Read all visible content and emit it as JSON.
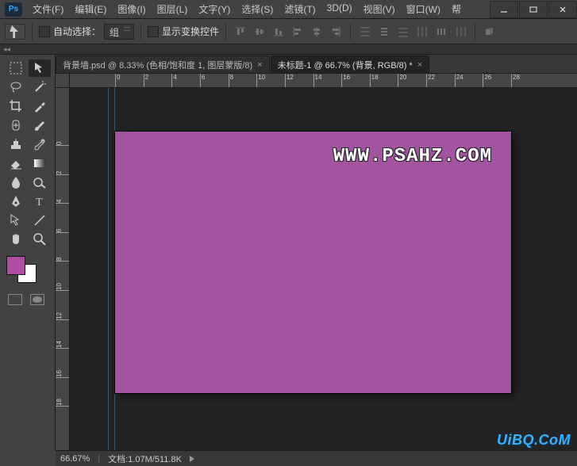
{
  "logo": "Ps",
  "menu": [
    "文件(F)",
    "编辑(E)",
    "图像(I)",
    "图层(L)",
    "文字(Y)",
    "选择(S)",
    "滤镜(T)",
    "3D(D)",
    "视图(V)",
    "窗口(W)",
    "帮"
  ],
  "options": {
    "auto_select_label": "自动选择：",
    "group_label": "组",
    "transform_label": "显示变换控件"
  },
  "tabs": [
    {
      "label": "背景墙.psd @ 8.33% (色相/饱和度 1, 图层蒙版/8)",
      "active": false
    },
    {
      "label": "未标题-1 @ 66.7% (背景, RGB/8) *",
      "active": true
    }
  ],
  "ruler_h": [
    0,
    2,
    4,
    6,
    8,
    10,
    12,
    14,
    16,
    18,
    20,
    22,
    24,
    26,
    28
  ],
  "ruler_v": [
    0,
    2,
    4,
    6,
    8,
    10,
    12,
    14,
    16,
    18
  ],
  "canvas": {
    "fill": "#a354a0",
    "text": "WWW.PSAHZ.COM"
  },
  "swatch": {
    "fg": "#b04fa2",
    "bg": "#ffffff"
  },
  "status": {
    "zoom": "66.67%",
    "doc_label": "文档",
    "doc_info": "1.07M/511.8K"
  },
  "watermark": "UiBQ.CoM"
}
